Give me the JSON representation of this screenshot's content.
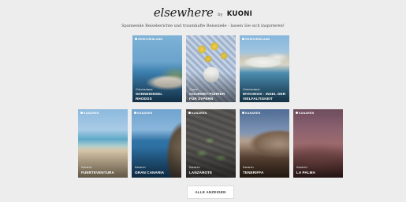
{
  "header": {
    "logo_script": "elsewhere",
    "logo_by": "by",
    "logo_brand": "KUONI",
    "tagline": "Spannende Reiseberichte und traumhafte Reiseziele - lassen Sie sich inspirieren!"
  },
  "tiles": [
    {
      "country": "GRIECHENLAND",
      "kicker": "Griechenland",
      "title": "SONNENINSEL RHODOS"
    },
    {
      "country": "",
      "kicker": "Zypern",
      "title": "GOURMET-FÜHRER FÜR ZYPERN"
    },
    {
      "country": "GRIECHENLAND",
      "kicker": "Griechenland",
      "title": "MYKONOS - INSEL DER VIELFALTIGKEIT"
    },
    {
      "country": "KANAREN",
      "kicker": "Kanaren",
      "title": "FUERTEVENTURA"
    },
    {
      "country": "KANAREN",
      "kicker": "Kanaren",
      "title": "GRAN CANARIA"
    },
    {
      "country": "KANAREN",
      "kicker": "Kanaren",
      "title": "LANZAROTE"
    },
    {
      "country": "KANAREN",
      "kicker": "Kanaren",
      "title": "TENERIFFA"
    },
    {
      "country": "KANAREN",
      "kicker": "Kanaren",
      "title": "LA PALMA"
    }
  ],
  "more_button": {
    "label": "ALLE ANZEIGEN"
  }
}
